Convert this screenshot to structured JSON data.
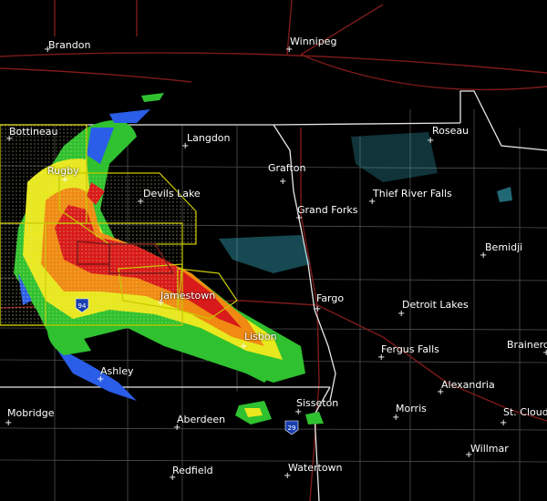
{
  "map": {
    "colors": {
      "background": "#000000",
      "state_border": "#ffffff",
      "county_line": "#5a5a5a",
      "road": "#8a1b1b",
      "warning_outline": "#c8c800",
      "radar_green": "#2fc12f",
      "radar_yellow": "#e8e81e",
      "radar_orange": "#f08a12",
      "radar_red": "#d81a1a",
      "radar_blue": "#2a5ee8",
      "radar_cyan": "#3fd0e8"
    },
    "cities": [
      {
        "name": "Brandon"
      },
      {
        "name": "Winnipeg"
      },
      {
        "name": "Bottineau"
      },
      {
        "name": "Langdon"
      },
      {
        "name": "Roseau"
      },
      {
        "name": "Rugby"
      },
      {
        "name": "Devils Lake"
      },
      {
        "name": "Grafton"
      },
      {
        "name": "Grand Forks"
      },
      {
        "name": "Thief River Falls"
      },
      {
        "name": "Bemidji"
      },
      {
        "name": "Jamestown"
      },
      {
        "name": "Fargo"
      },
      {
        "name": "Detroit Lakes"
      },
      {
        "name": "Lisbon"
      },
      {
        "name": "Fergus Falls"
      },
      {
        "name": "Brainerd"
      },
      {
        "name": "Ashley"
      },
      {
        "name": "Alexandria"
      },
      {
        "name": "Mobridge"
      },
      {
        "name": "Aberdeen"
      },
      {
        "name": "Sisseton"
      },
      {
        "name": "Morris"
      },
      {
        "name": "St. Cloud"
      },
      {
        "name": "Willmar"
      },
      {
        "name": "Redfield"
      },
      {
        "name": "Watertown"
      }
    ],
    "shields": [
      {
        "label": "94"
      },
      {
        "label": "29"
      }
    ]
  }
}
